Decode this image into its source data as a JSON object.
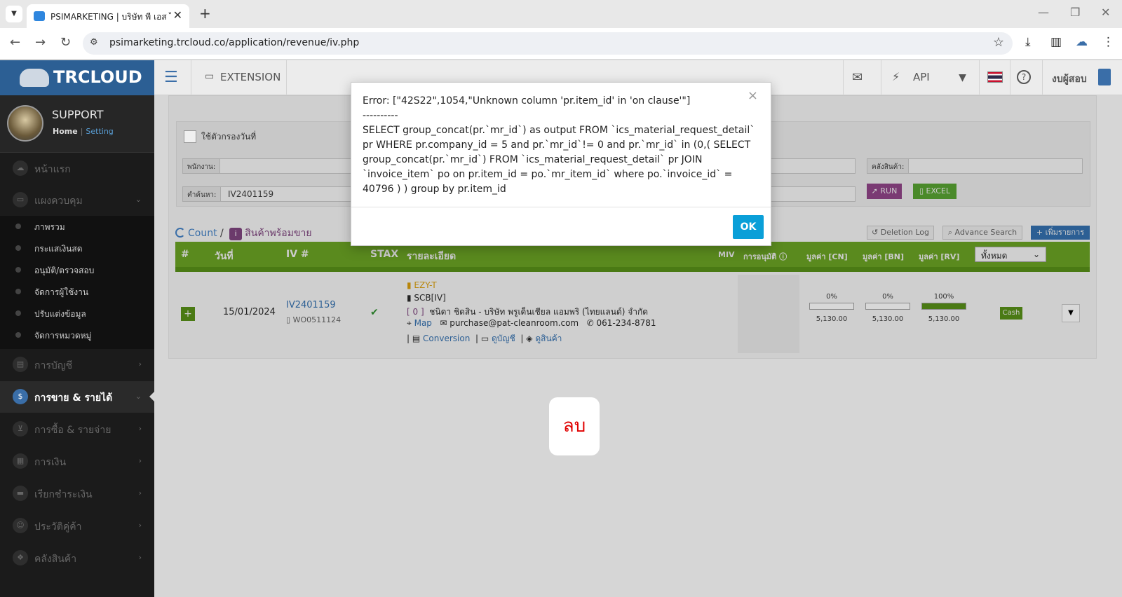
{
  "browser": {
    "tab_title": "PSIMARKETING | บริษัท พี เอส ไอ",
    "url": "psimarketing.trcloud.co/application/revenue/iv.php",
    "tab_list_icon": "chevron-down-icon",
    "close_glyph": "✕",
    "new_tab_glyph": "+"
  },
  "sidebar": {
    "logo": "TRCLOUD",
    "user_name": "SUPPORT",
    "home_link": "Home",
    "setting_link": "Setting",
    "items": [
      {
        "label": "หน้าแรก",
        "icon": "cloud-icon"
      },
      {
        "label": "แผงควบคุม",
        "icon": "monitor-icon"
      },
      {
        "label": "การบัญชี",
        "icon": "book-icon"
      },
      {
        "label": "การขาย & รายได้",
        "icon": "dollar-icon",
        "active": true
      },
      {
        "label": "การซื้อ & รายจ่าย",
        "icon": "cart-icon"
      },
      {
        "label": "การเงิน",
        "icon": "calendar-icon"
      },
      {
        "label": "เรียกชำระเงิน",
        "icon": "card-icon"
      },
      {
        "label": "ประวัติคู่ค้า",
        "icon": "contact-icon"
      },
      {
        "label": "คลังสินค้า",
        "icon": "cubes-icon"
      }
    ],
    "sub_items": [
      "ภาพรวม",
      "กระแสเงินสด",
      "อนุมัติ/ตรวจสอบ",
      "จัดการผู้ใช้งาน",
      "ปรับแต่งข้อมูล",
      "จัดการหมวดหมู่"
    ]
  },
  "topnav": {
    "extension": "EXTENSION",
    "api": "API",
    "test_account": "งบผู้สอบ"
  },
  "filters": {
    "use_date_filter": "ใช้ตัวกรองวันที่",
    "employee_label": "พนักงาน:",
    "search_label": "คำค้นหา:",
    "search_value": "IV2401159",
    "warehouse_label": "คลังสินค้า:",
    "run": "RUN",
    "excel": "EXCEL"
  },
  "list": {
    "count": "Count",
    "slash": "/",
    "ready_label": "สินค้าพร้อมขาย",
    "deletion_log": "Deletion Log",
    "advance_search": "Advance Search",
    "add_item": "+ เพิ่มรายการ",
    "columns": {
      "no": "#",
      "date": "วันที่",
      "iv": "IV #",
      "stax": "STAX",
      "detail": "รายละเอียด",
      "miv": "MIV",
      "approval": "การอนุมัติ",
      "cn": "มูลค่า [CN]",
      "bn": "มูลค่า [BN]",
      "rv": "มูลค่า [RV]",
      "filter_all": "ทั้งหมด"
    },
    "row": {
      "date": "15/01/2024",
      "iv_no": "IV2401159",
      "wo_no": "WO0511124",
      "stax": "✔",
      "tag": "EZY-T",
      "bank": "SCB[IV]",
      "code": "[ 0 ]",
      "customer": "ชนิดา ชิดสิน - บริษัท พรูเด็นเชียล แอมพริ (ไทยแลนด์) จำกัด",
      "map": "Map",
      "email": "purchase@pat-cleanroom.com",
      "phone": "061-234-8781",
      "conversion": "Conversion",
      "view_account": "ดูบัญชี",
      "view_product": "ดูสินค้า",
      "cn_pct": "0%",
      "cn_pct_value": 0,
      "cn_value": "5,130.00",
      "bn_pct": "0%",
      "bn_pct_value": 0,
      "bn_value": "5,130.00",
      "rv_pct": "100%",
      "rv_pct_value": 100,
      "rv_value": "5,130.00",
      "payment": "Cash"
    }
  },
  "dialog": {
    "message": "Error: [\"42S22\",1054,\"Unknown column 'pr.item_id' in 'on clause'\"]\n----------\nSELECT group_concat(pr.`mr_id`) as output FROM `ics_material_request_detail` pr WHERE pr.company_id = 5 and pr.`mr_id`!= 0 and pr.`mr_id` in (0,( SELECT group_concat(pr.`mr_id`) FROM `ics_material_request_detail` pr JOIN `invoice_item` po on pr.item_id = po.`mr_item_id` where po.`invoice_id` = 40796 ) ) group by pr.item_id",
    "close": "×",
    "ok": "OK"
  },
  "overlay_chip": "ลบ",
  "colors": {
    "brand_blue": "#2c5f94",
    "header_green": "#5a8a1e",
    "ok_button": "#0a9fd8",
    "delete_red": "#e00000"
  }
}
